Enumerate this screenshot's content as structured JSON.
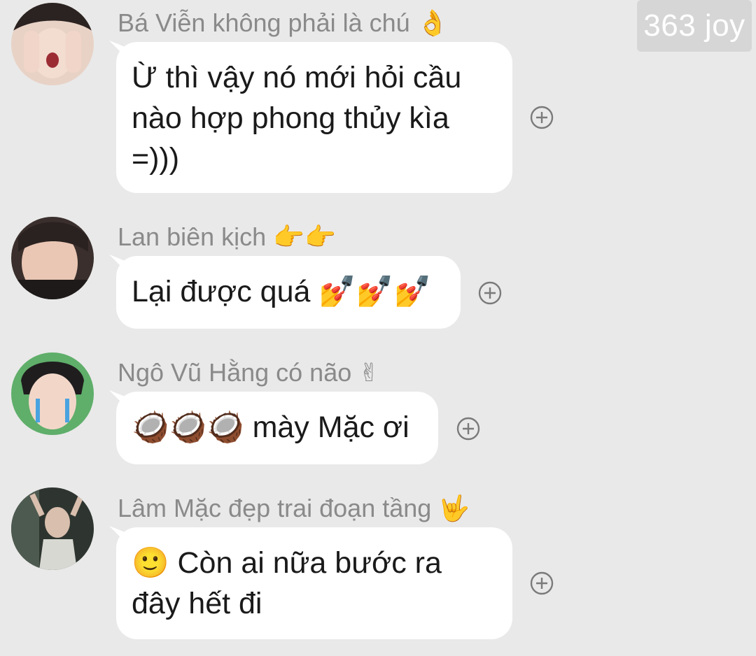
{
  "watermark": "363 joy",
  "messages": [
    {
      "sender": "Bá Viễn không phải là chú 👌",
      "lines": [
        "Ừ thì vậy nó mới hỏi cầu",
        "nào hợp phong thủy kìa",
        "=)))"
      ]
    },
    {
      "sender": "Lan biên kịch 👉👉",
      "lines": [
        "Lại được quá 💅💅💅"
      ]
    },
    {
      "sender": "Ngô Vũ Hằng có não ✌",
      "lines": [
        "🥥🥥🥥 mày Mặc ơi"
      ]
    },
    {
      "sender": "Lâm Mặc đẹp trai đoạn tầng 🤟",
      "lines": [
        "🙂 Còn ai nữa bước ra",
        "đây hết đi"
      ]
    }
  ],
  "colors": {
    "background": "#e9e9e9",
    "bubble": "#ffffff",
    "sender_text": "#8a8a8a",
    "message_text": "#1a1a1a"
  },
  "icons": {
    "reaction": "add-reaction-icon",
    "avatar": "user-avatar"
  }
}
